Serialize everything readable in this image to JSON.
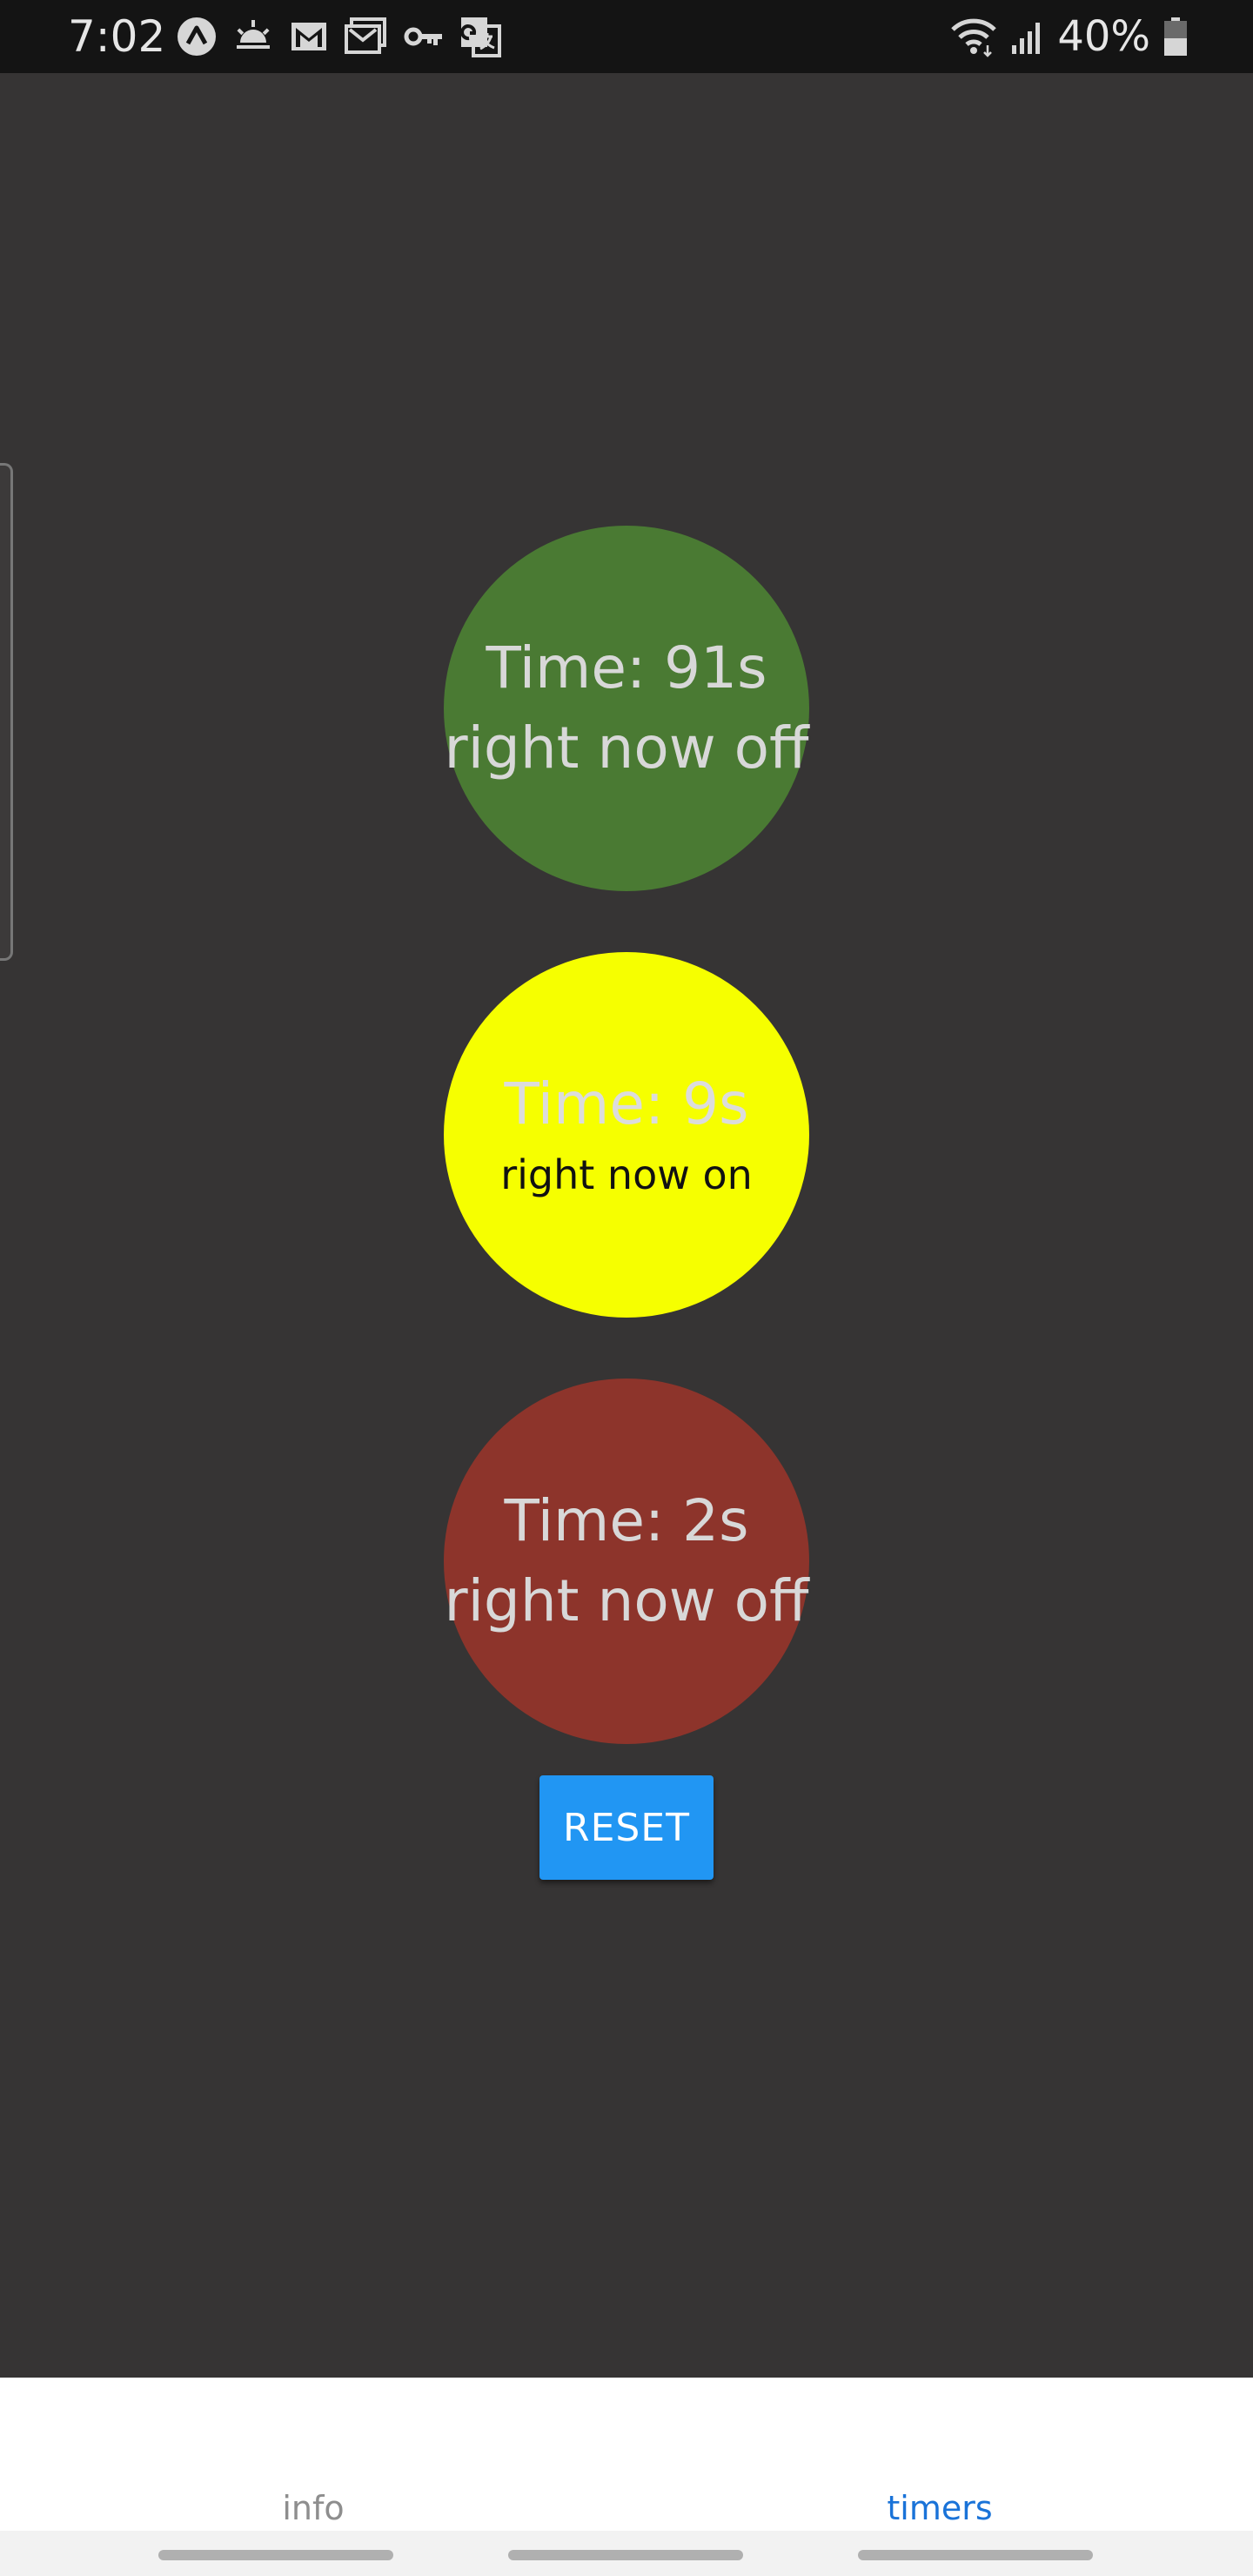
{
  "status_bar": {
    "time": "7:02",
    "left_icons": [
      "arrow-up-circle-icon",
      "sunrise-icon",
      "gmail-icon",
      "gmail-outline-icon",
      "key-icon",
      "translate-icon"
    ],
    "right_icons": [
      "wifi-icon",
      "signal-icon",
      "battery-icon"
    ],
    "battery_percent": "40%",
    "battery_level": 0.4
  },
  "lights": [
    {
      "time_text": "Time: 91s",
      "state_text": "right now off",
      "color": "#4a7a33"
    },
    {
      "time_text": "Time: 9s",
      "state_text": "right now on",
      "color": "#f6ff00"
    },
    {
      "time_text": "Time: 2s",
      "state_text": "right now off",
      "color": "#8d342b"
    }
  ],
  "reset_button": {
    "label": "RESET",
    "color": "#2196f3"
  },
  "tabs": [
    {
      "label": "info",
      "active": false
    },
    {
      "label": "timers",
      "active": true,
      "color": "#1a73d8"
    }
  ]
}
